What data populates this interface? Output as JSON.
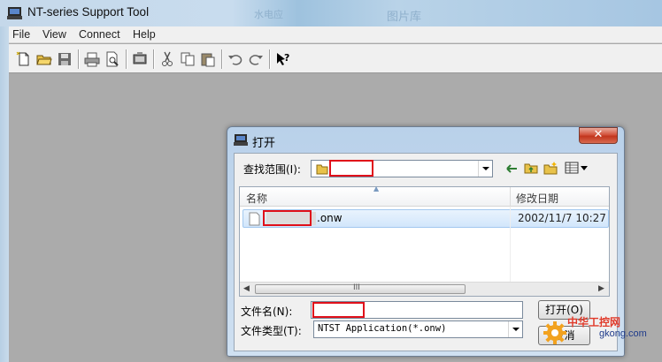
{
  "window": {
    "title": "NT-series Support Tool",
    "bg_ghost_1": "水电应",
    "bg_ghost_2": "图片库"
  },
  "menu": [
    "File",
    "View",
    "Connect",
    "Help"
  ],
  "toolbar": {
    "icons": [
      "new-file-icon",
      "open-folder-icon",
      "save-icon",
      "print-icon",
      "print-preview-icon",
      "transfer-icon",
      "cut-icon",
      "copy-icon",
      "paste-icon",
      "undo-icon",
      "redo-icon",
      "context-help-icon"
    ]
  },
  "dialog": {
    "title": "打开",
    "close": "✕",
    "lookin_label": "查找范围(I):",
    "lookin_value": "",
    "columns": {
      "name": "名称",
      "modified": "修改日期"
    },
    "files": [
      {
        "name": ".onw",
        "modified": "2002/11/7 10:27"
      }
    ],
    "scroll_grip": "III",
    "filename_label": "文件名(N):",
    "filename_value": "",
    "filetype_label": "文件类型(T):",
    "filetype_value": "NTST Application(*.onw)",
    "open_button": "打开(O)",
    "cancel_button": "取消"
  },
  "watermark": {
    "brand": "中华工控网",
    "url": "gkong.com"
  },
  "colors": {
    "highlight_box": "#e0101a",
    "selection": "#d2e6fb",
    "close_red": "#c2361e"
  }
}
